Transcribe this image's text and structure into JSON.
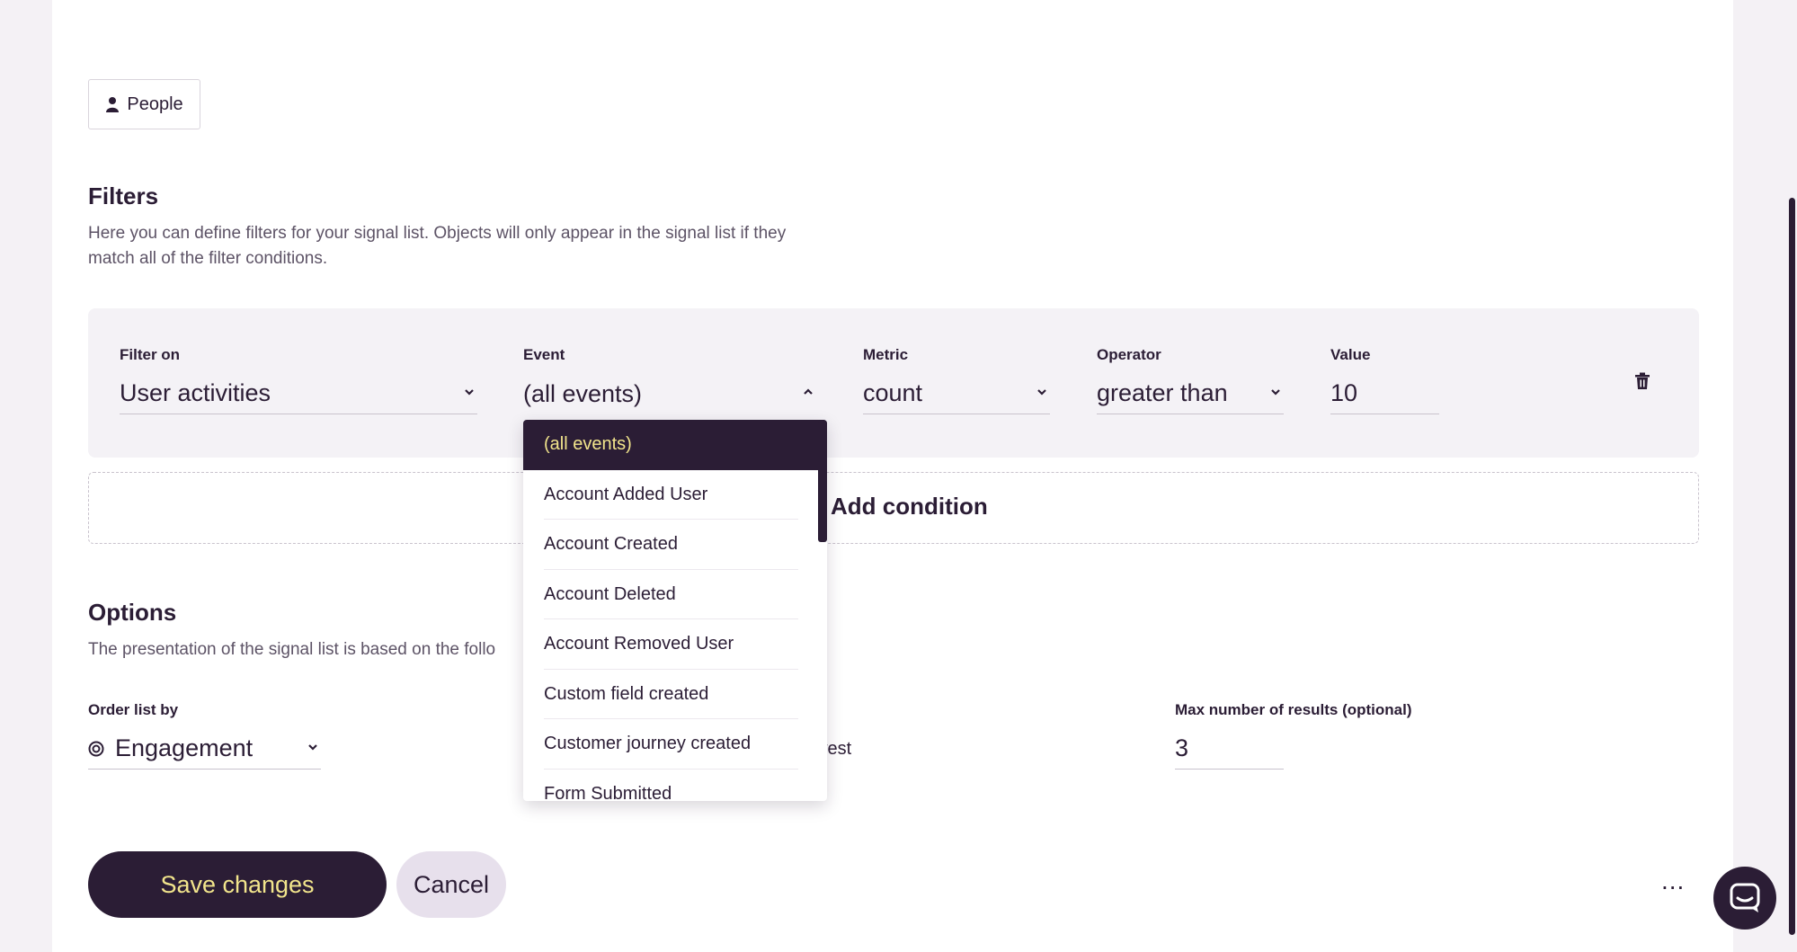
{
  "people_button": {
    "label": "People",
    "icon": "person-icon"
  },
  "filters": {
    "title": "Filters",
    "description_line1": "Here you can define filters for your signal list. Objects will only appear in the signal list if they",
    "description_line2": "match all of the filter conditions.",
    "row": {
      "filter_on": {
        "label": "Filter on",
        "value": "User activities"
      },
      "event": {
        "label": "Event",
        "value": "(all events)"
      },
      "metric": {
        "label": "Metric",
        "value": "count"
      },
      "operator": {
        "label": "Operator",
        "value": "greater than"
      },
      "value": {
        "label": "Value",
        "value": "10"
      }
    },
    "add_condition_label": "Add condition"
  },
  "event_dropdown": {
    "options": [
      "(all events)",
      "Account Added User",
      "Account Created",
      "Account Deleted",
      "Account Removed User",
      "Custom field created",
      "Customer journey created",
      "Form Submitted"
    ],
    "selected": "(all events)"
  },
  "options_section": {
    "title": "Options",
    "description": "The presentation of the signal list is based on the follo",
    "order_by": {
      "label": "Order list by",
      "value": "Engagement",
      "icon": "target-icon"
    },
    "partial_text": "west",
    "max_results": {
      "label": "Max number of results (optional)",
      "value": "3"
    }
  },
  "actions": {
    "save_label": "Save changes",
    "cancel_label": "Cancel",
    "more_label": "..."
  },
  "colors": {
    "primary": "#2b1d35",
    "accent_text": "#f2e58c",
    "panel_bg": "#f4f2f6",
    "page_bg": "#f4f1f5"
  }
}
